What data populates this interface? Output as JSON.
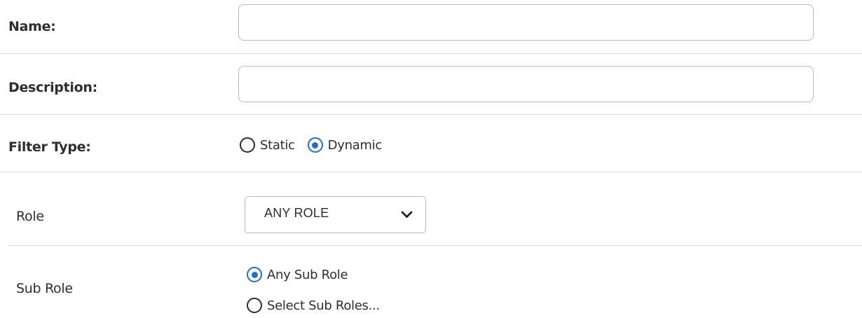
{
  "fields": {
    "name": {
      "label": "Name:",
      "value": "",
      "placeholder": ""
    },
    "description": {
      "label": "Description:",
      "value": "",
      "placeholder": ""
    },
    "filter_type": {
      "label": "Filter Type:",
      "options": [
        "Static",
        "Dynamic"
      ],
      "selected": "Dynamic"
    },
    "role": {
      "label": "Role",
      "selected": "ANY ROLE",
      "icon": "chevron-down-icon"
    },
    "sub_role": {
      "label": "Sub Role",
      "options": [
        "Any Sub Role",
        "Select Sub Roles..."
      ],
      "selected": "Any Sub Role"
    }
  },
  "colors": {
    "accent": "#1f6fd1",
    "divider": "#dcdcdc",
    "input_border": "#b9b9b9"
  }
}
